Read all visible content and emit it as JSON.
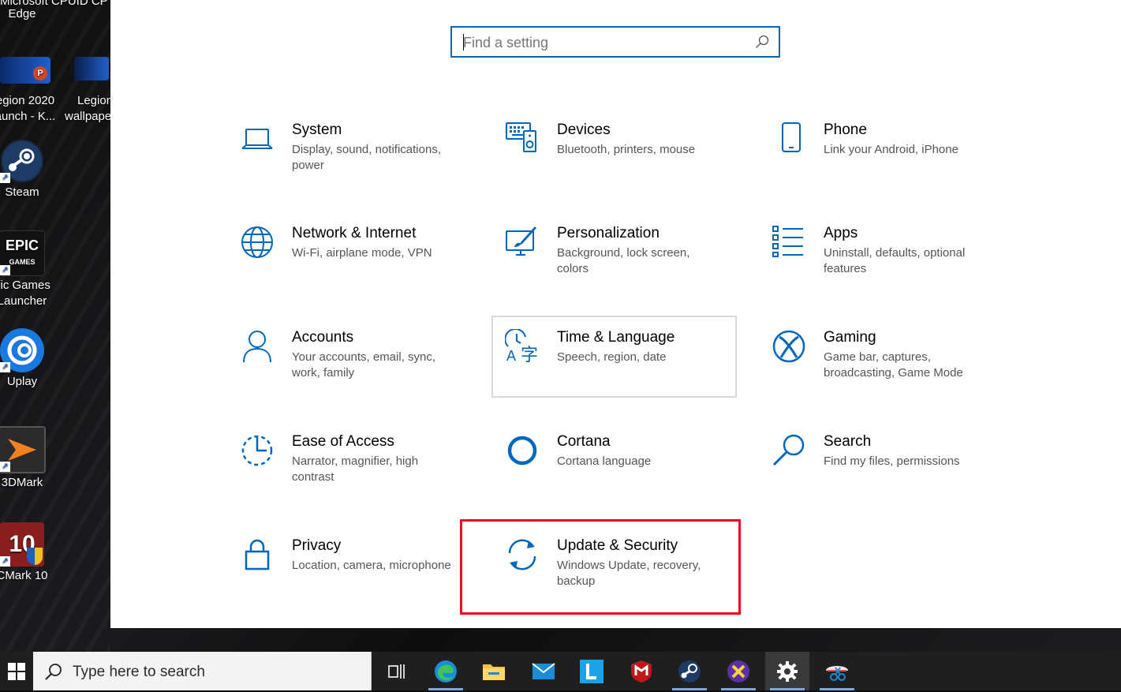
{
  "desktop": {
    "icons": [
      {
        "name": "edge",
        "label": "Microsoft Edge"
      },
      {
        "name": "legion-launch",
        "label": "egion 2020 aunch - K..."
      },
      {
        "name": "legion-wallpaper",
        "label": "Legion wallpape"
      },
      {
        "name": "steam",
        "label": "Steam"
      },
      {
        "name": "epic",
        "label": "pic Games Launcher"
      },
      {
        "name": "uplay",
        "label": "Uplay"
      },
      {
        "name": "3dmark",
        "label": "3DMark"
      },
      {
        "name": "pcmark",
        "label": "CMark 10"
      }
    ],
    "top_partial": "Microsoft  CPUID CP",
    "edge_label": "Edge",
    "legion1_l1": "egion 2020",
    "legion1_l2": "aunch - K...",
    "legion2_l1": "Legion",
    "legion2_l2": "wallpape",
    "steam_label": "Steam",
    "epic_l1": "pic Games",
    "epic_l2": "Launcher",
    "uplay_label": "Uplay",
    "mark3d_label": "3DMark",
    "pcmark_label": "CMark 10"
  },
  "settings": {
    "search": {
      "placeholder": "Find a setting",
      "value": ""
    },
    "tiles": [
      {
        "id": "system",
        "title": "System",
        "desc": "Display, sound, notifications, power"
      },
      {
        "id": "devices",
        "title": "Devices",
        "desc": "Bluetooth, printers, mouse"
      },
      {
        "id": "phone",
        "title": "Phone",
        "desc": "Link your Android, iPhone"
      },
      {
        "id": "network",
        "title": "Network & Internet",
        "desc": "Wi-Fi, airplane mode, VPN"
      },
      {
        "id": "personalization",
        "title": "Personalization",
        "desc": "Background, lock screen, colors"
      },
      {
        "id": "apps",
        "title": "Apps",
        "desc": "Uninstall, defaults, optional features"
      },
      {
        "id": "accounts",
        "title": "Accounts",
        "desc": "Your accounts, email, sync, work, family"
      },
      {
        "id": "time-language",
        "title": "Time & Language",
        "desc": "Speech, region, date"
      },
      {
        "id": "gaming",
        "title": "Gaming",
        "desc": "Game bar, captures, broadcasting, Game Mode"
      },
      {
        "id": "ease-of-access",
        "title": "Ease of Access",
        "desc": "Narrator, magnifier, high contrast"
      },
      {
        "id": "cortana",
        "title": "Cortana",
        "desc": "Cortana language"
      },
      {
        "id": "search",
        "title": "Search",
        "desc": "Find my files, permissions"
      },
      {
        "id": "privacy",
        "title": "Privacy",
        "desc": "Location, camera, microphone"
      },
      {
        "id": "update-security",
        "title": "Update & Security",
        "desc": "Windows Update, recovery, backup"
      }
    ],
    "accent_color": "#0067c0",
    "highlight_color": "#e81123"
  },
  "taskbar": {
    "search_placeholder": "Type here to search",
    "apps": [
      "task-view",
      "edge",
      "file-explorer",
      "mail",
      "lenovo-vantage",
      "mcafee",
      "steam",
      "xmedia",
      "settings",
      "snip-sketch"
    ]
  }
}
